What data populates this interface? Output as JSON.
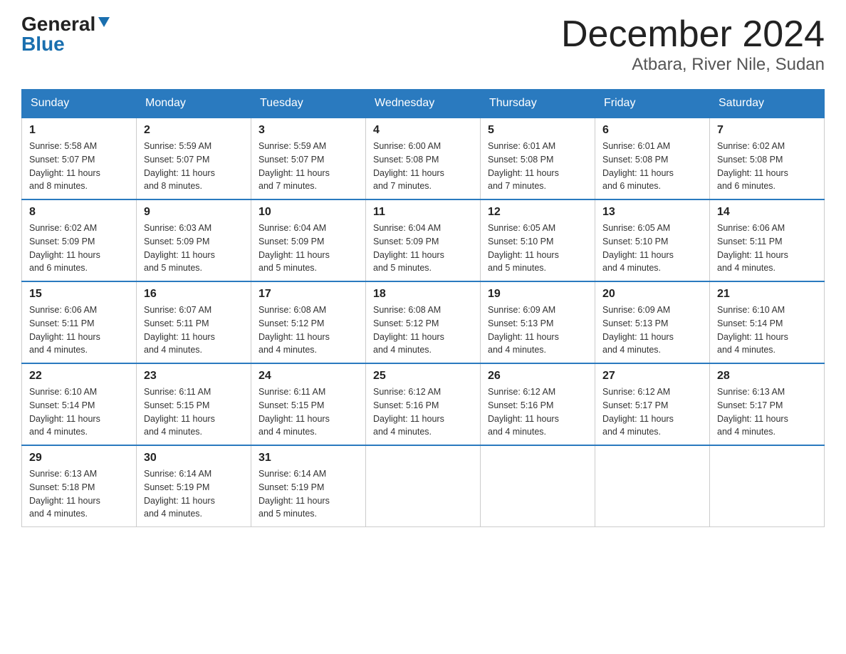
{
  "logo": {
    "general": "General",
    "blue": "Blue"
  },
  "title": {
    "month_year": "December 2024",
    "location": "Atbara, River Nile, Sudan"
  },
  "weekdays": [
    "Sunday",
    "Monday",
    "Tuesday",
    "Wednesday",
    "Thursday",
    "Friday",
    "Saturday"
  ],
  "weeks": [
    [
      {
        "day": "1",
        "sunrise": "5:58 AM",
        "sunset": "5:07 PM",
        "daylight": "11 hours and 8 minutes."
      },
      {
        "day": "2",
        "sunrise": "5:59 AM",
        "sunset": "5:07 PM",
        "daylight": "11 hours and 8 minutes."
      },
      {
        "day": "3",
        "sunrise": "5:59 AM",
        "sunset": "5:07 PM",
        "daylight": "11 hours and 7 minutes."
      },
      {
        "day": "4",
        "sunrise": "6:00 AM",
        "sunset": "5:08 PM",
        "daylight": "11 hours and 7 minutes."
      },
      {
        "day": "5",
        "sunrise": "6:01 AM",
        "sunset": "5:08 PM",
        "daylight": "11 hours and 7 minutes."
      },
      {
        "day": "6",
        "sunrise": "6:01 AM",
        "sunset": "5:08 PM",
        "daylight": "11 hours and 6 minutes."
      },
      {
        "day": "7",
        "sunrise": "6:02 AM",
        "sunset": "5:08 PM",
        "daylight": "11 hours and 6 minutes."
      }
    ],
    [
      {
        "day": "8",
        "sunrise": "6:02 AM",
        "sunset": "5:09 PM",
        "daylight": "11 hours and 6 minutes."
      },
      {
        "day": "9",
        "sunrise": "6:03 AM",
        "sunset": "5:09 PM",
        "daylight": "11 hours and 5 minutes."
      },
      {
        "day": "10",
        "sunrise": "6:04 AM",
        "sunset": "5:09 PM",
        "daylight": "11 hours and 5 minutes."
      },
      {
        "day": "11",
        "sunrise": "6:04 AM",
        "sunset": "5:09 PM",
        "daylight": "11 hours and 5 minutes."
      },
      {
        "day": "12",
        "sunrise": "6:05 AM",
        "sunset": "5:10 PM",
        "daylight": "11 hours and 5 minutes."
      },
      {
        "day": "13",
        "sunrise": "6:05 AM",
        "sunset": "5:10 PM",
        "daylight": "11 hours and 4 minutes."
      },
      {
        "day": "14",
        "sunrise": "6:06 AM",
        "sunset": "5:11 PM",
        "daylight": "11 hours and 4 minutes."
      }
    ],
    [
      {
        "day": "15",
        "sunrise": "6:06 AM",
        "sunset": "5:11 PM",
        "daylight": "11 hours and 4 minutes."
      },
      {
        "day": "16",
        "sunrise": "6:07 AM",
        "sunset": "5:11 PM",
        "daylight": "11 hours and 4 minutes."
      },
      {
        "day": "17",
        "sunrise": "6:08 AM",
        "sunset": "5:12 PM",
        "daylight": "11 hours and 4 minutes."
      },
      {
        "day": "18",
        "sunrise": "6:08 AM",
        "sunset": "5:12 PM",
        "daylight": "11 hours and 4 minutes."
      },
      {
        "day": "19",
        "sunrise": "6:09 AM",
        "sunset": "5:13 PM",
        "daylight": "11 hours and 4 minutes."
      },
      {
        "day": "20",
        "sunrise": "6:09 AM",
        "sunset": "5:13 PM",
        "daylight": "11 hours and 4 minutes."
      },
      {
        "day": "21",
        "sunrise": "6:10 AM",
        "sunset": "5:14 PM",
        "daylight": "11 hours and 4 minutes."
      }
    ],
    [
      {
        "day": "22",
        "sunrise": "6:10 AM",
        "sunset": "5:14 PM",
        "daylight": "11 hours and 4 minutes."
      },
      {
        "day": "23",
        "sunrise": "6:11 AM",
        "sunset": "5:15 PM",
        "daylight": "11 hours and 4 minutes."
      },
      {
        "day": "24",
        "sunrise": "6:11 AM",
        "sunset": "5:15 PM",
        "daylight": "11 hours and 4 minutes."
      },
      {
        "day": "25",
        "sunrise": "6:12 AM",
        "sunset": "5:16 PM",
        "daylight": "11 hours and 4 minutes."
      },
      {
        "day": "26",
        "sunrise": "6:12 AM",
        "sunset": "5:16 PM",
        "daylight": "11 hours and 4 minutes."
      },
      {
        "day": "27",
        "sunrise": "6:12 AM",
        "sunset": "5:17 PM",
        "daylight": "11 hours and 4 minutes."
      },
      {
        "day": "28",
        "sunrise": "6:13 AM",
        "sunset": "5:17 PM",
        "daylight": "11 hours and 4 minutes."
      }
    ],
    [
      {
        "day": "29",
        "sunrise": "6:13 AM",
        "sunset": "5:18 PM",
        "daylight": "11 hours and 4 minutes."
      },
      {
        "day": "30",
        "sunrise": "6:14 AM",
        "sunset": "5:19 PM",
        "daylight": "11 hours and 4 minutes."
      },
      {
        "day": "31",
        "sunrise": "6:14 AM",
        "sunset": "5:19 PM",
        "daylight": "11 hours and 5 minutes."
      },
      null,
      null,
      null,
      null
    ]
  ],
  "labels": {
    "sunrise": "Sunrise:",
    "sunset": "Sunset:",
    "daylight": "Daylight:"
  }
}
